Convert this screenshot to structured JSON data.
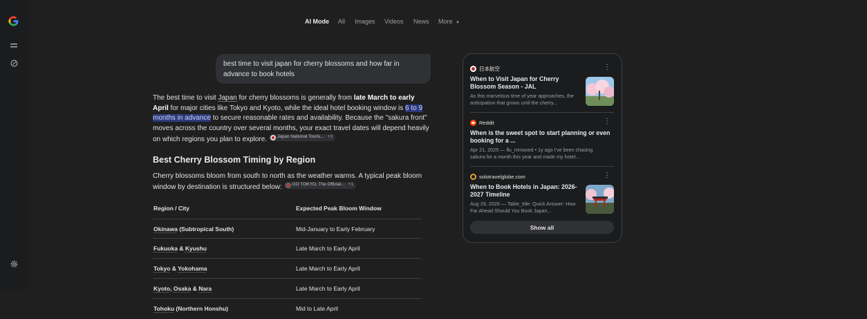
{
  "nav": {
    "tabs": [
      {
        "label": "AI Mode",
        "active": true
      },
      {
        "label": "All"
      },
      {
        "label": "Images"
      },
      {
        "label": "Videos"
      },
      {
        "label": "News"
      },
      {
        "label": "More"
      }
    ]
  },
  "query": "best time to visit japan for cherry blossoms and how far in advance to book hotels",
  "answer": {
    "p1_a": "The best time to visit ",
    "p1_japan": "Japan",
    "p1_b": " for cherry blossoms is generally from ",
    "p1_bold1": "late March to early April",
    "p1_c": " for major cities like Tokyo and Kyoto, while the ideal hotel booking window is ",
    "p1_hl": "6 to 9 months in advance",
    "p1_d": " to secure reasonable rates and availability. Because the \"sakura front\" moves across the country over several months, your exact travel dates will depend heavily on which regions you plan to explore.",
    "chip1": "Japan National Touris...",
    "chip1_more": "+3",
    "heading": "Best Cherry Blossom Timing by Region",
    "p2": "Cherry blossoms bloom from south to north as the weather warms. A typical peak bloom window by destination is structured below:",
    "chip2": "GO TOKYO, The Official...",
    "chip2_more": "+1"
  },
  "table": {
    "headers": [
      "Region / City",
      "Expected Peak Bloom Window"
    ],
    "rows": [
      {
        "parts": [
          "Okinawa",
          " (Subtropical South)"
        ],
        "window": "Mid-January to Early February"
      },
      {
        "parts": [
          "Fukuoka",
          " & ",
          "Kyushu"
        ],
        "window": "Late March to Early April"
      },
      {
        "parts": [
          "Tokyo",
          " & ",
          "Yokohama"
        ],
        "window": "Late March to Early April"
      },
      {
        "parts": [
          "Kyoto",
          ", ",
          "Osaka",
          " & ",
          "Nara"
        ],
        "window": "Late March to Early April"
      },
      {
        "parts": [
          "Tohoku",
          " (Northern Honshu)"
        ],
        "window": "Mid to Late April"
      }
    ]
  },
  "sources": {
    "cards": [
      {
        "site": "日本航空",
        "title": "When to Visit Japan for Cherry Blossom Season - JAL",
        "snippet": "As this marvelous time of year approaches, the anticipation that grows until the cherry..."
      },
      {
        "site": "Reddit",
        "title": "When is the sweet spot to start planning or even booking for a ...",
        "snippet": "Apr 21, 2025 — flu_mmoxed • 1y ago I've been chasing sakura for a month this year and made my hotel..."
      },
      {
        "site": "solotravelglobe.com",
        "title": "When to Book Hotels in Japan: 2026-2027 Timeline",
        "snippet": "Aug 29, 2026 — Table_title: Quick Answer: How Far Ahead Should You Book Japan..."
      }
    ],
    "show_all": "Show all"
  },
  "colors": {
    "background": "#1f1f1f",
    "highlight": "#2d3a7a",
    "panel": "#1b1c1d"
  }
}
